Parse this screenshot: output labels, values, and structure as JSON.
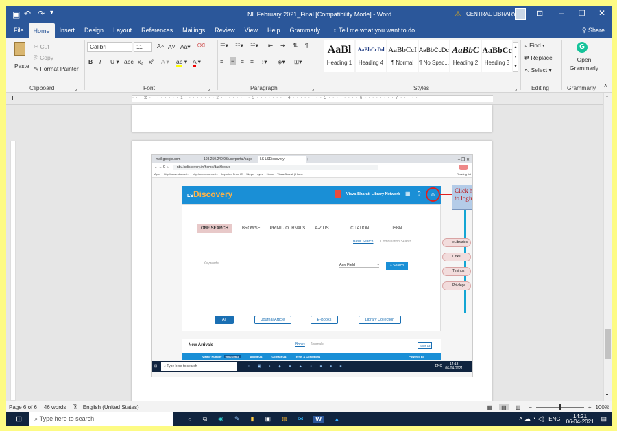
{
  "titlebar": {
    "title": "NL February 2021_Final [Compatibility Mode] - Word",
    "library": "CENTRAL LIBRARY",
    "warn": "⚠"
  },
  "menus": [
    "File",
    "Home",
    "Insert",
    "Design",
    "Layout",
    "References",
    "Mailings",
    "Review",
    "View",
    "Help",
    "Grammarly"
  ],
  "tellme": "Tell me what you want to do",
  "share": "Share",
  "clipboard": {
    "paste": "Paste",
    "cut": "Cut",
    "copy": "Copy",
    "painter": "Format Painter",
    "label": "Clipboard"
  },
  "font": {
    "name": "Calibri",
    "size": "11",
    "label": "Font"
  },
  "paragraph": {
    "label": "Paragraph"
  },
  "styles": {
    "label": "Styles",
    "items": [
      {
        "preview": "AaBl",
        "name": "Heading 1"
      },
      {
        "preview": "AaBbCcDd",
        "name": "Heading 4"
      },
      {
        "preview": "AaBbCcI",
        "name": "¶ Normal"
      },
      {
        "preview": "AaBbCcDc",
        "name": "¶ No Spac..."
      },
      {
        "preview": "AaBbC",
        "name": "Heading 2"
      },
      {
        "preview": "AaBbCc",
        "name": "Heading 3"
      }
    ]
  },
  "editing": {
    "find": "Find",
    "replace": "Replace",
    "select": "Select",
    "label": "Editing"
  },
  "grammarly": {
    "open": "Open",
    "name": "Grammarly",
    "label": "Grammarly"
  },
  "status": {
    "page": "Page 6 of 6",
    "words": "46 words",
    "lang": "English (United States)",
    "zoom": "100%"
  },
  "taskbar": {
    "search": "Type here to search",
    "lang": "ENG",
    "time": "14:21",
    "date": "06-04-2021"
  },
  "screenshot": {
    "tabs": [
      "mail.google.com",
      "103.250.240.93/userportal/page",
      "LS LSDiscovery"
    ],
    "url": "nbu.lsdiscovery.in/home/dashboard",
    "bookmarks": [
      "Apps",
      "http://www.nbu.ac.i...",
      "http://www.nbu.ac.i...",
      "Imported From IE",
      "Skype",
      "oyes",
      "Home",
      "Visva-Bharati | Home",
      "Reading list"
    ],
    "brand_ls": "LS",
    "brand": "Discovery",
    "network": "Visva-Bharati Library Network",
    "callout": "Click here to login",
    "searchtabs": [
      "ONE SEARCH",
      "BROWSE",
      "PRINT JOURNALS",
      "A-Z LIST",
      "CITATION",
      "ISBN"
    ],
    "basic": "Basic Search",
    "combination": "Combination Search",
    "keywords": "Keywords",
    "anyfield": "Any Field",
    "searchbtn": "Search",
    "filters": [
      "All",
      "Journal Article",
      "E-Books",
      "Library Collection"
    ],
    "side": [
      "eLibraries",
      "Links",
      "Timings",
      "Privilege"
    ],
    "arrivals": "New Arrivals",
    "books": "Books",
    "journals": "Journals",
    "showall": "Show All",
    "footer": {
      "visitor": "Visitor Number",
      "count": "000034983",
      "about": "About Us",
      "contact": "Contact Us",
      "terms": "Terms & Conditions",
      "powered": "Powered By"
    },
    "inner_search": "Type here to search",
    "inner_time": "14:13",
    "inner_date": "06-04-2021",
    "inner_lang": "ENG"
  }
}
